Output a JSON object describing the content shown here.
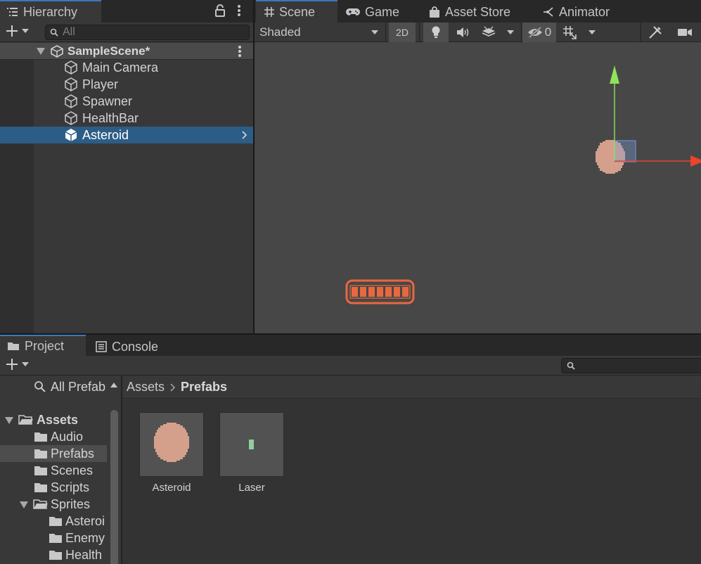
{
  "hierarchy": {
    "tab_label": "Hierarchy",
    "search_placeholder": "All",
    "scene_name": "SampleScene*",
    "items": [
      {
        "label": "Main Camera"
      },
      {
        "label": "Player"
      },
      {
        "label": "Spawner"
      },
      {
        "label": "HealthBar"
      },
      {
        "label": "Asteroid",
        "selected": true
      }
    ]
  },
  "scene_view": {
    "tabs": [
      {
        "label": "Scene",
        "icon": "grid-icon"
      },
      {
        "label": "Game",
        "icon": "gamepad-icon"
      },
      {
        "label": "Asset Store",
        "icon": "shopping-bag-icon"
      },
      {
        "label": "Animator",
        "icon": "animator-icon"
      }
    ],
    "draw_mode": "Shaded",
    "mode_2d_label": "2D",
    "hidden_count": "0",
    "colors": {
      "asteroid": "#d4a08c",
      "healthbar": "#e8683e",
      "gizmo_y": "#8fe35a",
      "gizmo_x": "#e8442e",
      "selection": "#2c5d87"
    }
  },
  "project": {
    "tabs": [
      {
        "label": "Project",
        "icon": "folder-icon"
      },
      {
        "label": "Console",
        "icon": "console-icon"
      }
    ],
    "favorites_label": "All Prefab",
    "tree": [
      {
        "label": "Assets",
        "bold": true
      },
      {
        "label": "Audio"
      },
      {
        "label": "Prefabs",
        "selected": true
      },
      {
        "label": "Scenes"
      },
      {
        "label": "Scripts"
      },
      {
        "label": "Sprites"
      },
      {
        "label": "Asteroi"
      },
      {
        "label": "Enemy"
      },
      {
        "label": "Health"
      }
    ],
    "breadcrumb": [
      "Assets",
      "Prefabs"
    ],
    "assets": [
      {
        "label": "Asteroid"
      },
      {
        "label": "Laser"
      }
    ]
  }
}
